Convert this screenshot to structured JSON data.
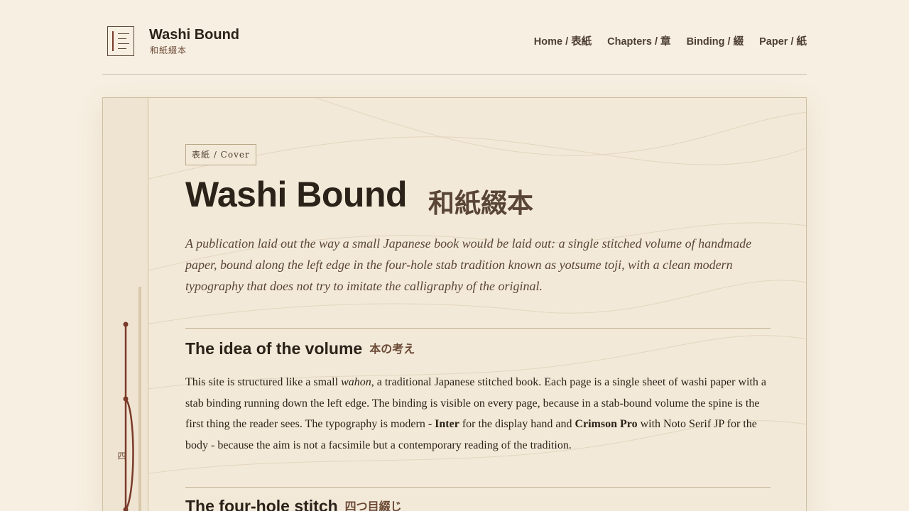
{
  "header": {
    "brand_title": "Washi Bound",
    "brand_subtitle": "和紙綴本",
    "nav": [
      "Home / 表紙",
      "Chapters / 章",
      "Binding / 綴",
      "Paper / 紙"
    ]
  },
  "page": {
    "tag": "表紙 / Cover",
    "title": "Washi Bound",
    "title_jp": "和紙綴本",
    "lede": "A publication laid out the way a small Japanese book would be laid out: a single stitched volume of handmade paper, bound along the left edge in the four-hole stab tradition known as yotsume toji, with a clean modern typography that does not try to imitate the calligraphy of the original.",
    "spine_char": "四",
    "sections": [
      {
        "heading": "The idea of the volume",
        "heading_jp": "本の考え",
        "p1": "This site is structured like a small ",
        "em1": "wahon",
        "p2": ", a traditional Japanese stitched book. Each page is a single sheet of washi paper with a stab binding running down the left edge. The binding is visible on every page, because in a stab-bound volume the spine is the first thing the reader sees. The typography is modern - ",
        "b1": "Inter",
        "p3": " for the display hand and ",
        "b2": "Crimson Pro",
        "p4": " with Noto Serif JP for the body - because the aim is not a facsimile but a contemporary reading of the tradition."
      },
      {
        "heading": "The four-hole stitch",
        "heading_jp": "四つ目綴じ"
      }
    ]
  },
  "colors": {
    "background": "#f7efe1",
    "paper": "#f3e9d8",
    "thread": "#7a3a2a",
    "ink": "#2b2219"
  }
}
